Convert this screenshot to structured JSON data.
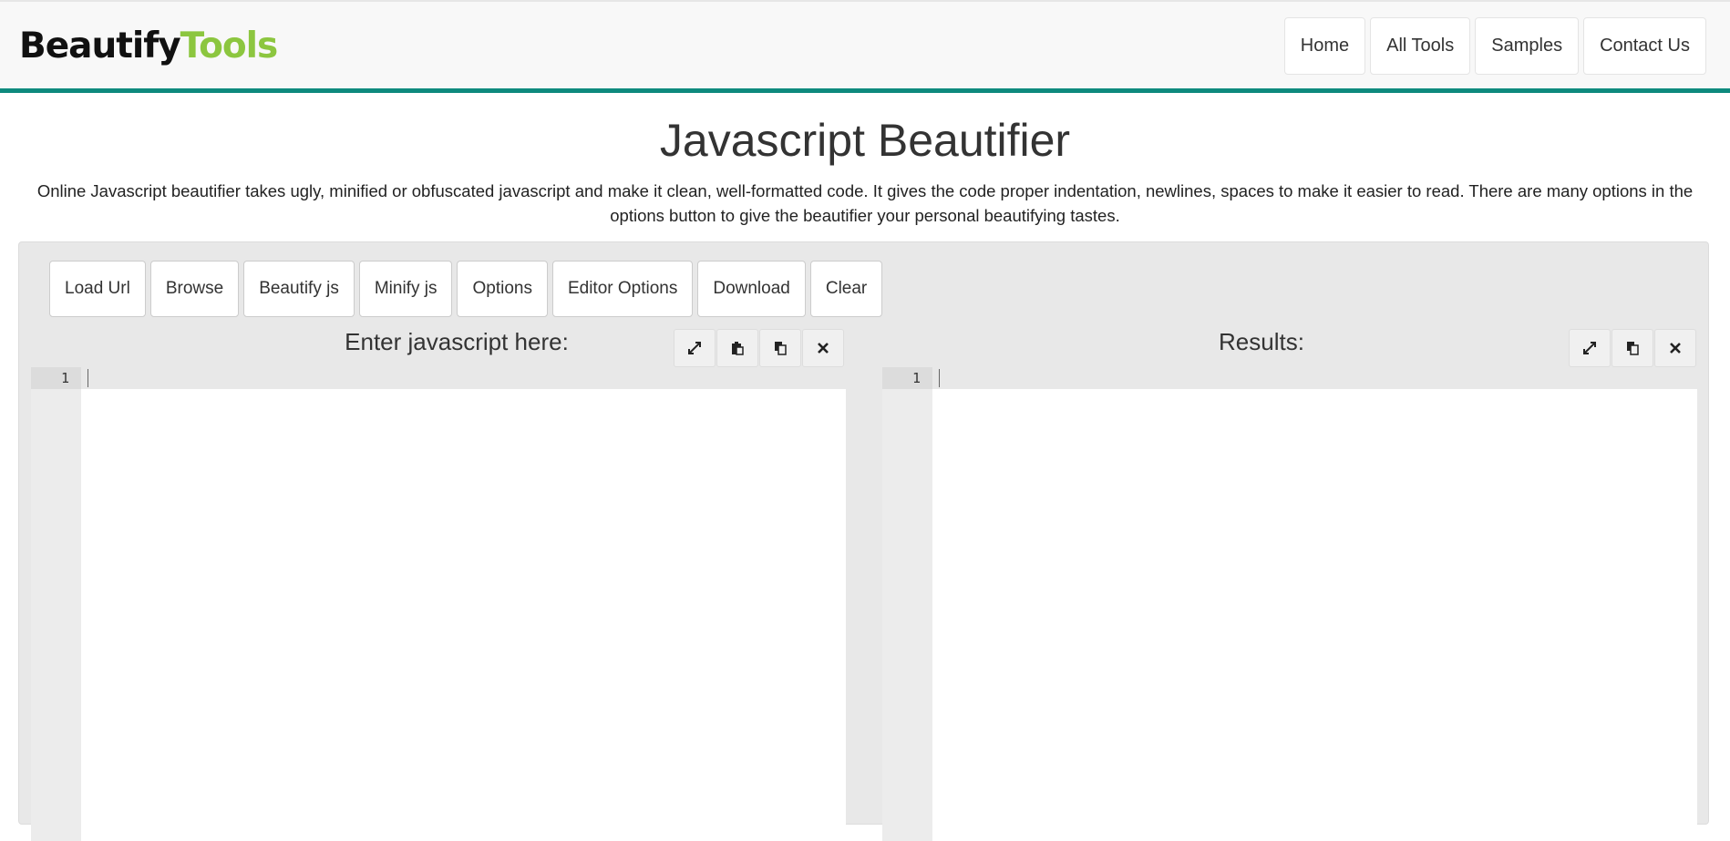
{
  "brand": {
    "part1": "Beautify",
    "part2": "Tools"
  },
  "nav": {
    "items": [
      "Home",
      "All Tools",
      "Samples",
      "Contact Us"
    ]
  },
  "page": {
    "title": "Javascript Beautifier",
    "description": "Online Javascript beautifier takes ugly, minified or obfuscated javascript and make it clean, well-formatted code. It gives the code proper indentation, newlines, spaces to make it easier to read. There are many options in the options button to give the beautifier your personal beautifying tastes."
  },
  "toolbar": {
    "buttons": [
      "Load Url",
      "Browse",
      "Beautify js",
      "Minify js",
      "Options",
      "Editor Options",
      "Download",
      "Clear"
    ]
  },
  "input_editor": {
    "heading": "Enter javascript here:",
    "line_number": "1",
    "icons": [
      "expand-icon",
      "paste-icon",
      "copy-icon",
      "close-icon"
    ]
  },
  "output_editor": {
    "heading": "Results:",
    "line_number": "1",
    "icons": [
      "expand-icon",
      "copy-icon",
      "close-icon"
    ]
  },
  "colors": {
    "accent": "#0e8a7e",
    "brand_green": "#8cc63f"
  }
}
